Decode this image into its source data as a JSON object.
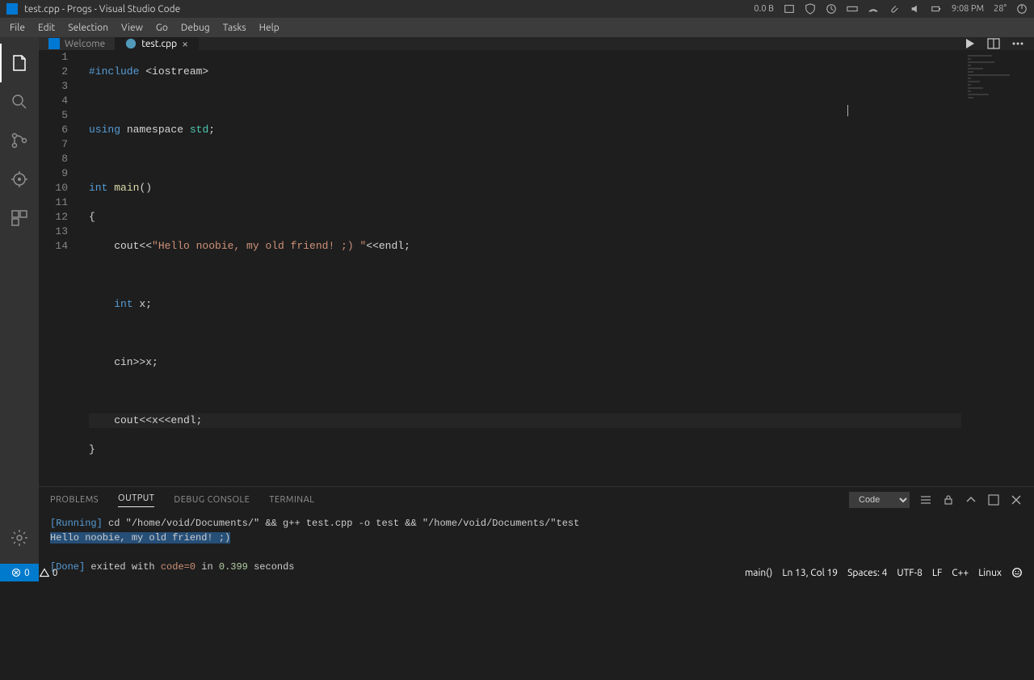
{
  "titlebar": {
    "title": "test.cpp - Progs - Visual Studio Code",
    "net": "0.0 B",
    "time": "9:08 PM",
    "temp": "28°"
  },
  "menu": [
    "File",
    "Edit",
    "Selection",
    "View",
    "Go",
    "Debug",
    "Tasks",
    "Help"
  ],
  "tabs": {
    "welcome": "Welcome",
    "file": "test.cpp"
  },
  "code": {
    "l1_a": "#include",
    "l1_b": " <iostream>",
    "l3_a": "using",
    "l3_b": " namespace ",
    "l3_c": "std",
    "l3_d": ";",
    "l5_a": "int",
    "l5_b": " ",
    "l5_c": "main",
    "l5_d": "()",
    "l6": "{",
    "l7_a": "    cout<<",
    "l7_b": "\"Hello noobie, my old friend! ;) \"",
    "l7_c": "<<endl;",
    "l9_a": "    ",
    "l9_b": "int",
    "l9_c": " x;",
    "l11": "    cin>>x;",
    "l13": "    cout<<x<<endl;",
    "l14": "}"
  },
  "panel": {
    "tabs": [
      "PROBLEMS",
      "OUTPUT",
      "DEBUG CONSOLE",
      "TERMINAL"
    ],
    "select": "Code",
    "out_running": "[Running]",
    "out_cmd": " cd \"/home/void/Documents/\" && g++ test.cpp -o test && \"/home/void/Documents/\"test",
    "out_hello": "Hello noobie, my old friend! ;)",
    "out_done": "[Done]",
    "out_exit_a": " exited with ",
    "out_exit_b": "code=0",
    "out_exit_c": " in ",
    "out_time": "0.399",
    "out_exit_d": " seconds"
  },
  "status": {
    "errors": "0",
    "warnings": "0",
    "branch": "main()",
    "pos": "Ln 13, Col 19",
    "spaces": "Spaces: 4",
    "encoding": "UTF-8",
    "eol": "LF",
    "lang": "C++",
    "os": "Linux"
  },
  "chart_data": null
}
